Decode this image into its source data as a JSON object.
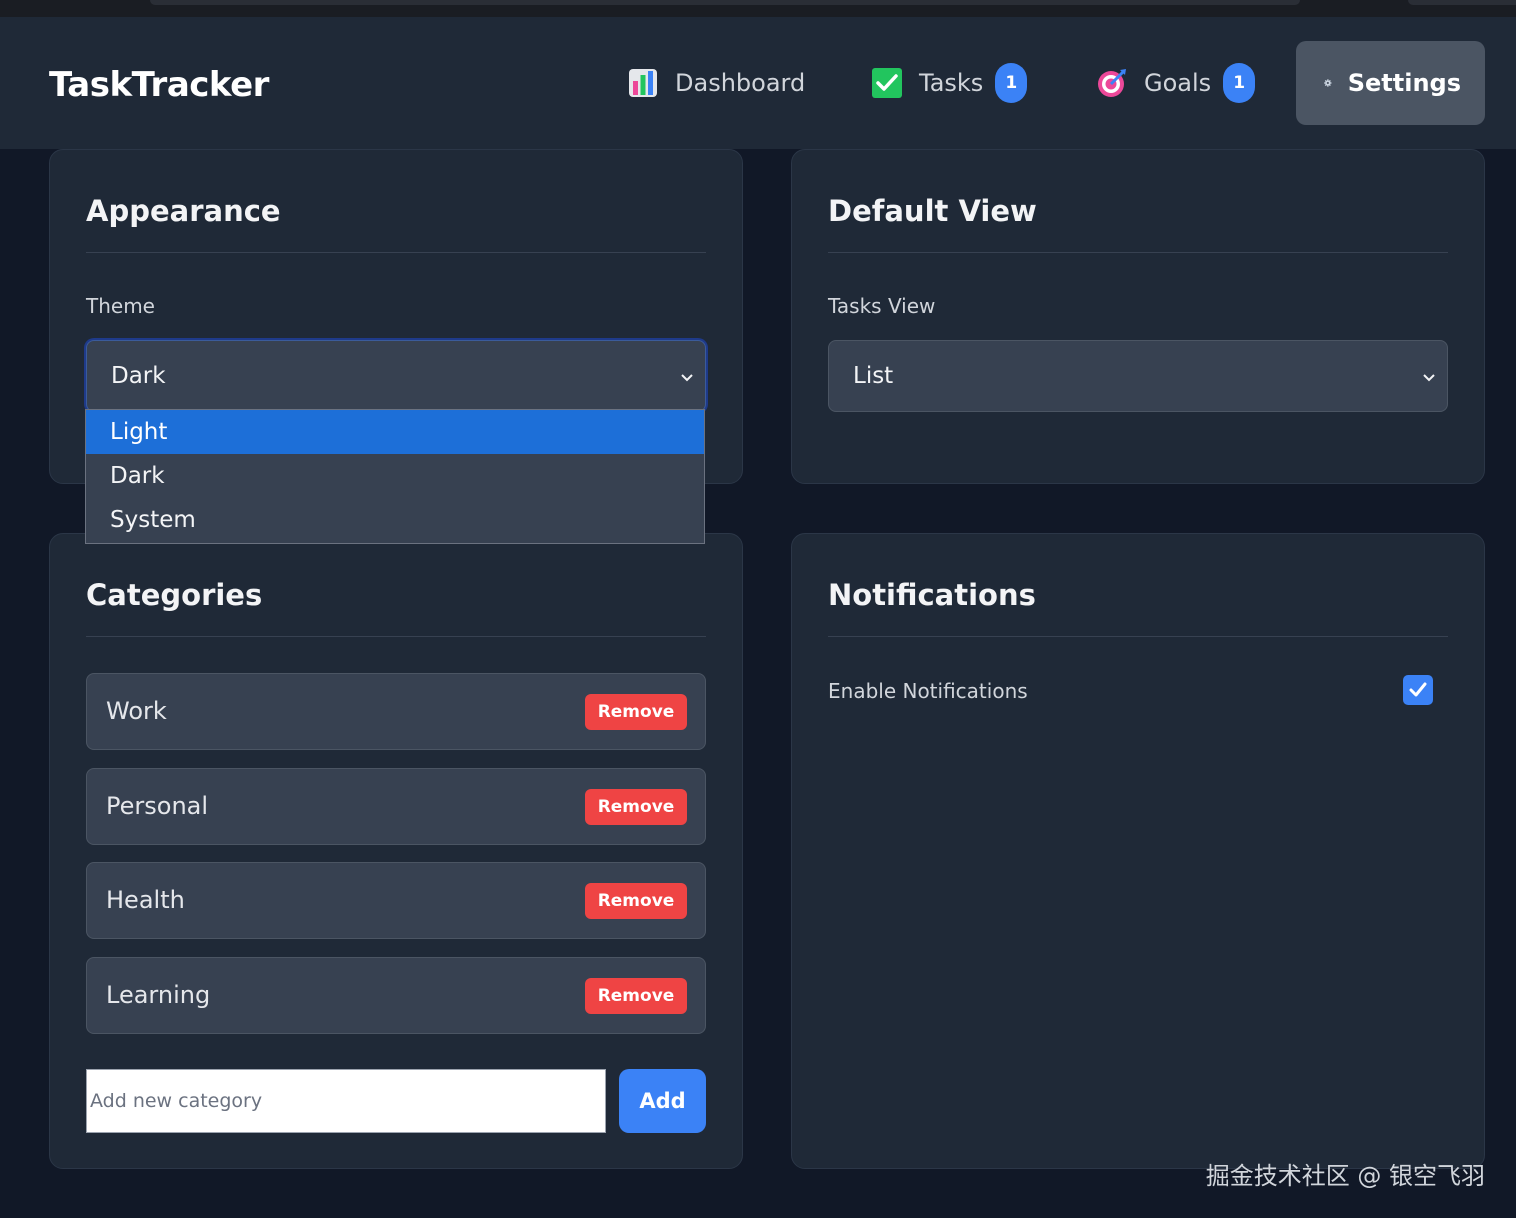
{
  "app": {
    "title": "TaskTracker"
  },
  "nav": {
    "items": [
      {
        "label": "Dashboard",
        "icon": "bar-chart-icon"
      },
      {
        "label": "Tasks",
        "icon": "checkmark-icon",
        "badge": "1"
      },
      {
        "label": "Goals",
        "icon": "target-icon",
        "badge": "1"
      },
      {
        "label": "Settings",
        "icon": "gear-icon",
        "active": true
      }
    ]
  },
  "appearance": {
    "title": "Appearance",
    "theme_label": "Theme",
    "theme_value": "Dark",
    "theme_options": [
      {
        "label": "Light",
        "highlighted": true
      },
      {
        "label": "Dark"
      },
      {
        "label": "System"
      }
    ]
  },
  "default_view": {
    "title": "Default View",
    "tasks_view_label": "Tasks View",
    "tasks_view_value": "List"
  },
  "categories": {
    "title": "Categories",
    "items": [
      {
        "name": "Work"
      },
      {
        "name": "Personal"
      },
      {
        "name": "Health"
      },
      {
        "name": "Learning"
      }
    ],
    "remove_label": "Remove",
    "add_placeholder": "Add new category",
    "add_label": "Add"
  },
  "notifications": {
    "title": "Notifications",
    "enable_label": "Enable Notifications",
    "enabled": true
  },
  "watermark": "掘金技术社区 @ 银空飞羽",
  "colors": {
    "background": "#111827",
    "card": "#1f2937",
    "accent": "#3b82f6",
    "danger": "#ef4444",
    "highlight": "#1d6fd8"
  }
}
